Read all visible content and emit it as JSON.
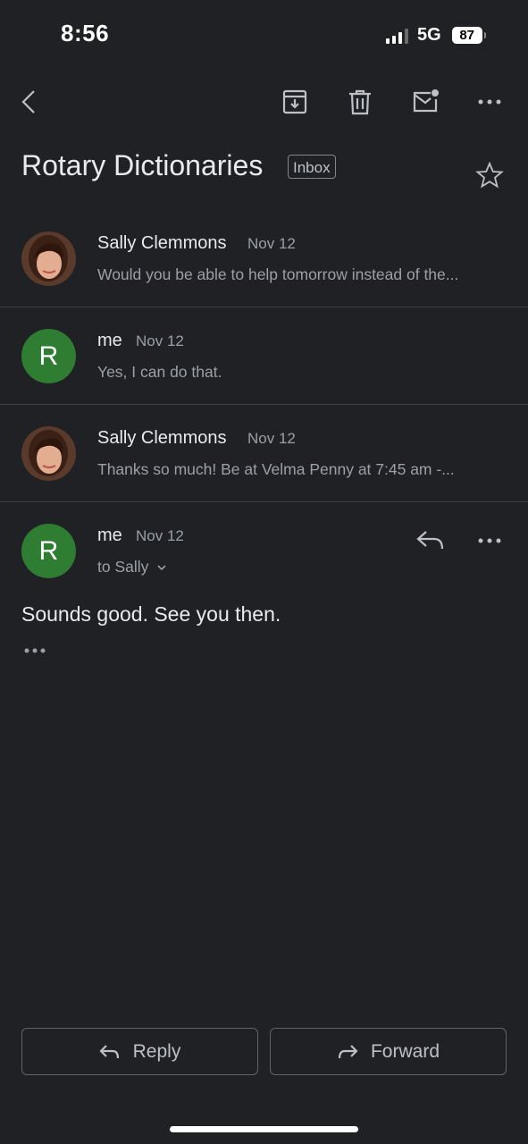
{
  "status_bar": {
    "time": "8:56",
    "network": "5G",
    "battery": "87"
  },
  "toolbar": {
    "icons": [
      "back-icon",
      "archive-icon",
      "trash-icon",
      "mark-unread-icon",
      "more-icon"
    ]
  },
  "thread": {
    "subject": "Rotary Dictionaries",
    "label": "Inbox"
  },
  "messages": [
    {
      "sender": "Sally Clemmons",
      "date": "Nov 12",
      "snippet": "Would you be able to help tomorrow instead of the..."
    },
    {
      "sender": "me",
      "avatar_letter": "R",
      "date": "Nov 12",
      "snippet": "Yes, I can do that."
    },
    {
      "sender": "Sally Clemmons",
      "date": "Nov 12",
      "snippet": "Thanks so much! Be at Velma Penny at 7:45 am -..."
    },
    {
      "sender": "me",
      "avatar_letter": "R",
      "date": "Nov 12",
      "to": "to Sally",
      "body": "Sounds good. See you then."
    }
  ],
  "actions": {
    "reply": "Reply",
    "forward": "Forward"
  },
  "colors": {
    "background": "#202124",
    "avatar_green": "#2e7d32",
    "divider": "#3c4043"
  }
}
